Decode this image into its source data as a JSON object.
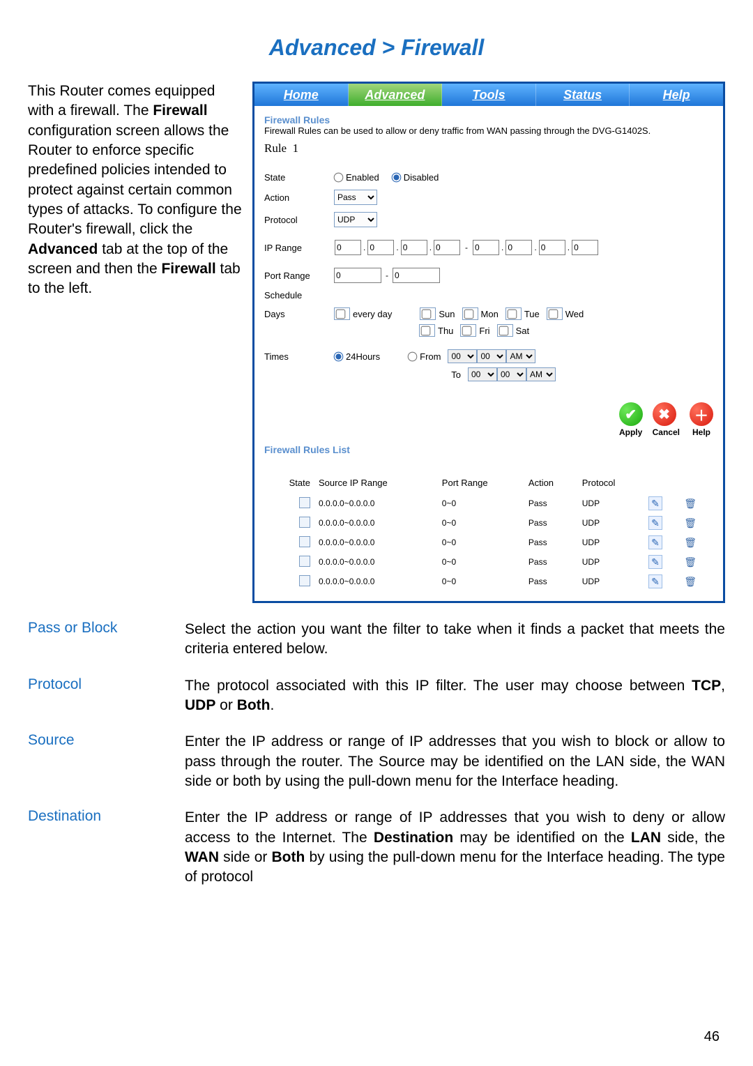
{
  "title": "Advanced > Firewall",
  "left_text": {
    "p1a": "This Router comes equipped with a firewall. The ",
    "b1": "Firewall",
    "p1b": " configuration screen allows the Router to enforce specific predefined policies intended to protect against certain common types of attacks. To configure the Router's firewall, click the ",
    "b2": "Advanced",
    "p1c": " tab at the top of the screen and then the ",
    "b3": "Firewall",
    "p1d": " tab to the left."
  },
  "panel": {
    "tabs": [
      "Home",
      "Advanced",
      "Tools",
      "Status",
      "Help"
    ],
    "active_tab": "Advanced",
    "section1_title": "Firewall Rules",
    "section1_desc": "Firewall Rules can be used to allow or deny traffic from WAN passing through the DVG-G1402S.",
    "rule_label": "Rule",
    "rule_number": "1",
    "form": {
      "state_label": "State",
      "state_enabled": "Enabled",
      "state_disabled": "Disabled",
      "state_value": "disabled",
      "action_label": "Action",
      "action_value": "Pass",
      "protocol_label": "Protocol",
      "protocol_value": "UDP",
      "ip_range_label": "IP Range",
      "ip_values": [
        "0",
        "0",
        "0",
        "0",
        "0",
        "0",
        "0",
        "0"
      ],
      "port_range_label": "Port Range",
      "port_values": [
        "0",
        "0"
      ],
      "schedule_label": "Schedule",
      "days_label": "Days",
      "everyday": "every day",
      "days": [
        "Sun",
        "Mon",
        "Tue",
        "Wed",
        "Thu",
        "Fri",
        "Sat"
      ],
      "times_label": "Times",
      "times_24": "24Hours",
      "times_from": "From",
      "times_to": "To",
      "time_hh": "00",
      "time_mm": "00",
      "time_ap": "AM"
    },
    "actions": {
      "apply": "Apply",
      "cancel": "Cancel",
      "help": "Help"
    },
    "rules_list_title": "Firewall Rules List",
    "columns": [
      "State",
      "Source IP Range",
      "Port Range",
      "Action",
      "Protocol"
    ],
    "rows": [
      {
        "ip": "0.0.0.0~0.0.0.0",
        "port": "0~0",
        "action": "Pass",
        "proto": "UDP"
      },
      {
        "ip": "0.0.0.0~0.0.0.0",
        "port": "0~0",
        "action": "Pass",
        "proto": "UDP"
      },
      {
        "ip": "0.0.0.0~0.0.0.0",
        "port": "0~0",
        "action": "Pass",
        "proto": "UDP"
      },
      {
        "ip": "0.0.0.0~0.0.0.0",
        "port": "0~0",
        "action": "Pass",
        "proto": "UDP"
      },
      {
        "ip": "0.0.0.0~0.0.0.0",
        "port": "0~0",
        "action": "Pass",
        "proto": "UDP"
      }
    ]
  },
  "defs": {
    "pass_term": "Pass or Block",
    "pass_body": "Select the action you want the filter to take when it finds a packet that meets the criteria entered below.",
    "proto_term": "Protocol",
    "proto_body_a": "The protocol associated with this IP filter. The user may choose between ",
    "proto_b1": "TCP",
    "proto_body_b": ", ",
    "proto_b2": "UDP",
    "proto_body_c": " or ",
    "proto_b3": "Both",
    "proto_body_d": ".",
    "src_term": "Source",
    "src_body": "Enter the IP address or range of IP addresses that you wish to block or allow to pass through the router. The Source may be identified on the LAN side, the WAN side or both by using the pull-down menu for the Interface heading.",
    "dest_term": "Destination",
    "dest_body_a": "Enter the IP address or range of IP addresses that you wish to deny or allow access to the Internet. The ",
    "dest_b1": "Destination",
    "dest_body_b": " may be identified on the ",
    "dest_b2": "LAN",
    "dest_body_c": " side, the ",
    "dest_b3": "WAN",
    "dest_body_d": " side or ",
    "dest_b4": "Both",
    "dest_body_e": " by using the pull-down menu for the Interface heading. The type of protocol"
  },
  "page_number": "46"
}
